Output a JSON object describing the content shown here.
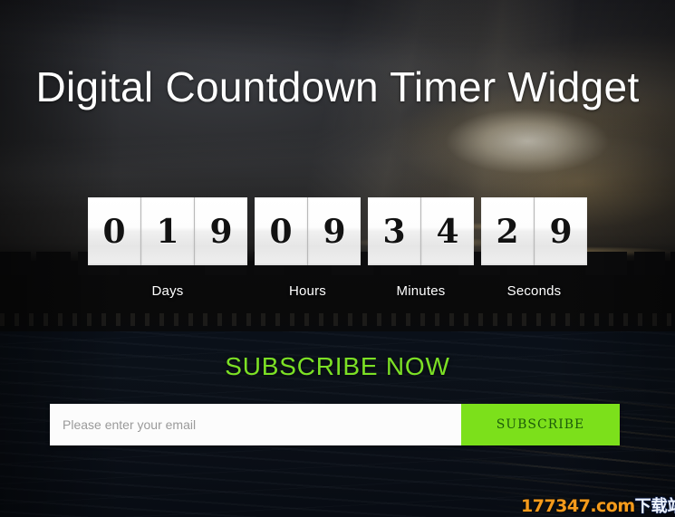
{
  "page": {
    "title": "Digital Countdown Timer Widget"
  },
  "countdown": {
    "groups": [
      {
        "key": "days",
        "label": "Days",
        "digits": [
          "0",
          "1",
          "9"
        ]
      },
      {
        "key": "hours",
        "label": "Hours",
        "digits": [
          "0",
          "9"
        ]
      },
      {
        "key": "minutes",
        "label": "Minutes",
        "digits": [
          "3",
          "4"
        ]
      },
      {
        "key": "seconds",
        "label": "Seconds",
        "digits": [
          "2",
          "9"
        ]
      }
    ]
  },
  "subscribe": {
    "heading": "SUBSCRIBE NOW",
    "input_placeholder": "Please enter your email",
    "input_value": "",
    "button_label": "SUBSCRIBE"
  },
  "watermark": {
    "domain": "177347.com",
    "suffix": "下载站"
  },
  "colors": {
    "accent_green": "#7ce01b",
    "heading_green": "#7ce025",
    "button_text": "#1c5c0a",
    "title_white": "#ffffff",
    "digit_text": "#121212",
    "watermark_orange": "#f59b1c",
    "watermark_blue": "#23396e"
  }
}
